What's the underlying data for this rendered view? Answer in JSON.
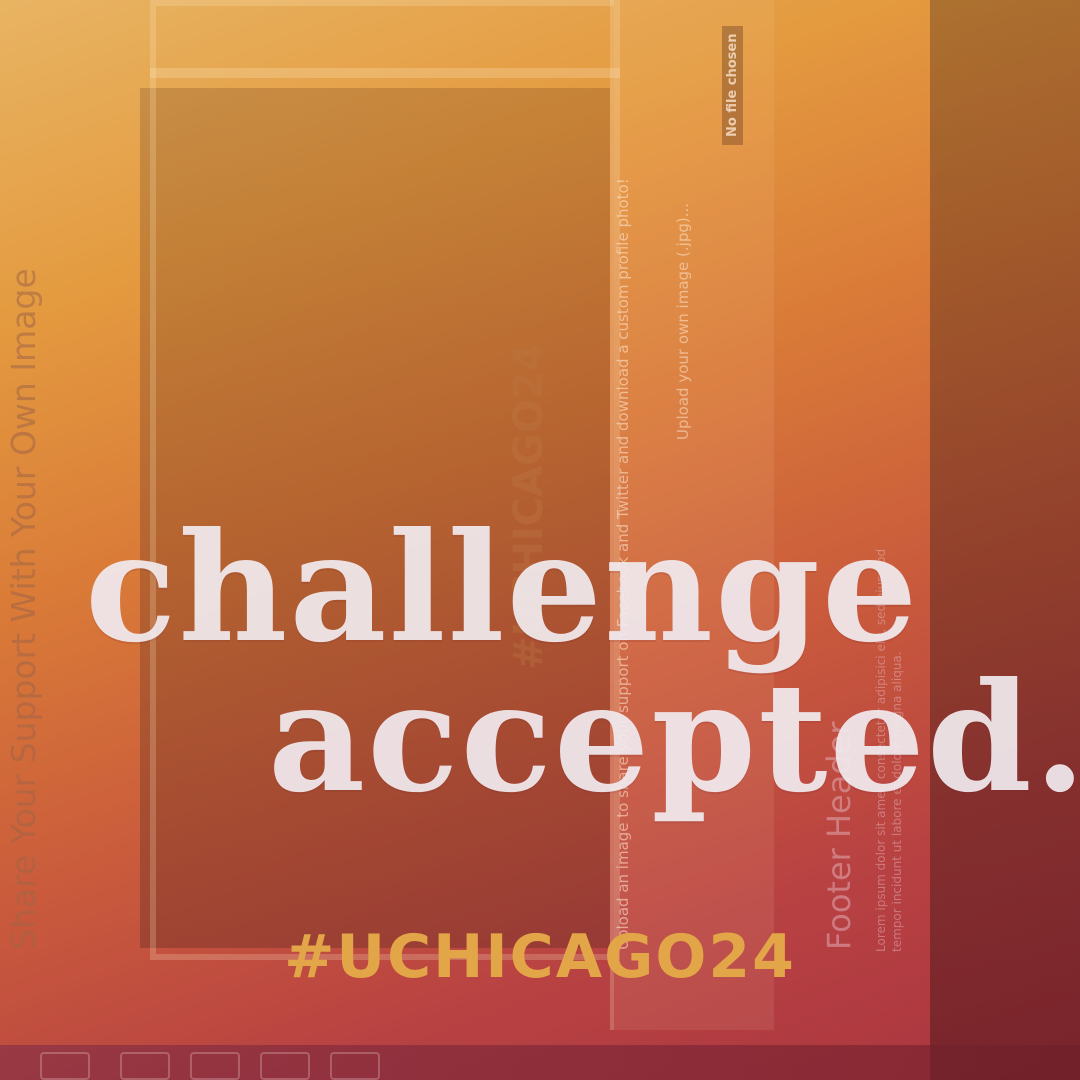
{
  "sidebar": {
    "title": "Share Your Support With Your Own Image"
  },
  "upload": {
    "instructions": "Upload an image to share your support on Facebook and Twitter and download a custom profile photo!",
    "label": "Upload your own image (.jpg)...",
    "file_button": "No file chosen"
  },
  "footer": {
    "header": "Footer Header",
    "text": "Lorem ipsum dolor sit amet, consectetur adipisici elit, sed eiusmod tempor incidunt ut labore et dolore magna aliqua."
  },
  "overlay": {
    "line1": "challenge",
    "line2": "accepted.",
    "hashtag": "#UCHICAGO24"
  },
  "colors": {
    "gradient_top": "#e8b463",
    "gradient_mid": "#d97a38",
    "gradient_bottom": "#a9343f",
    "hashtag": "#e2a547",
    "headline": "#f2ecf0"
  }
}
